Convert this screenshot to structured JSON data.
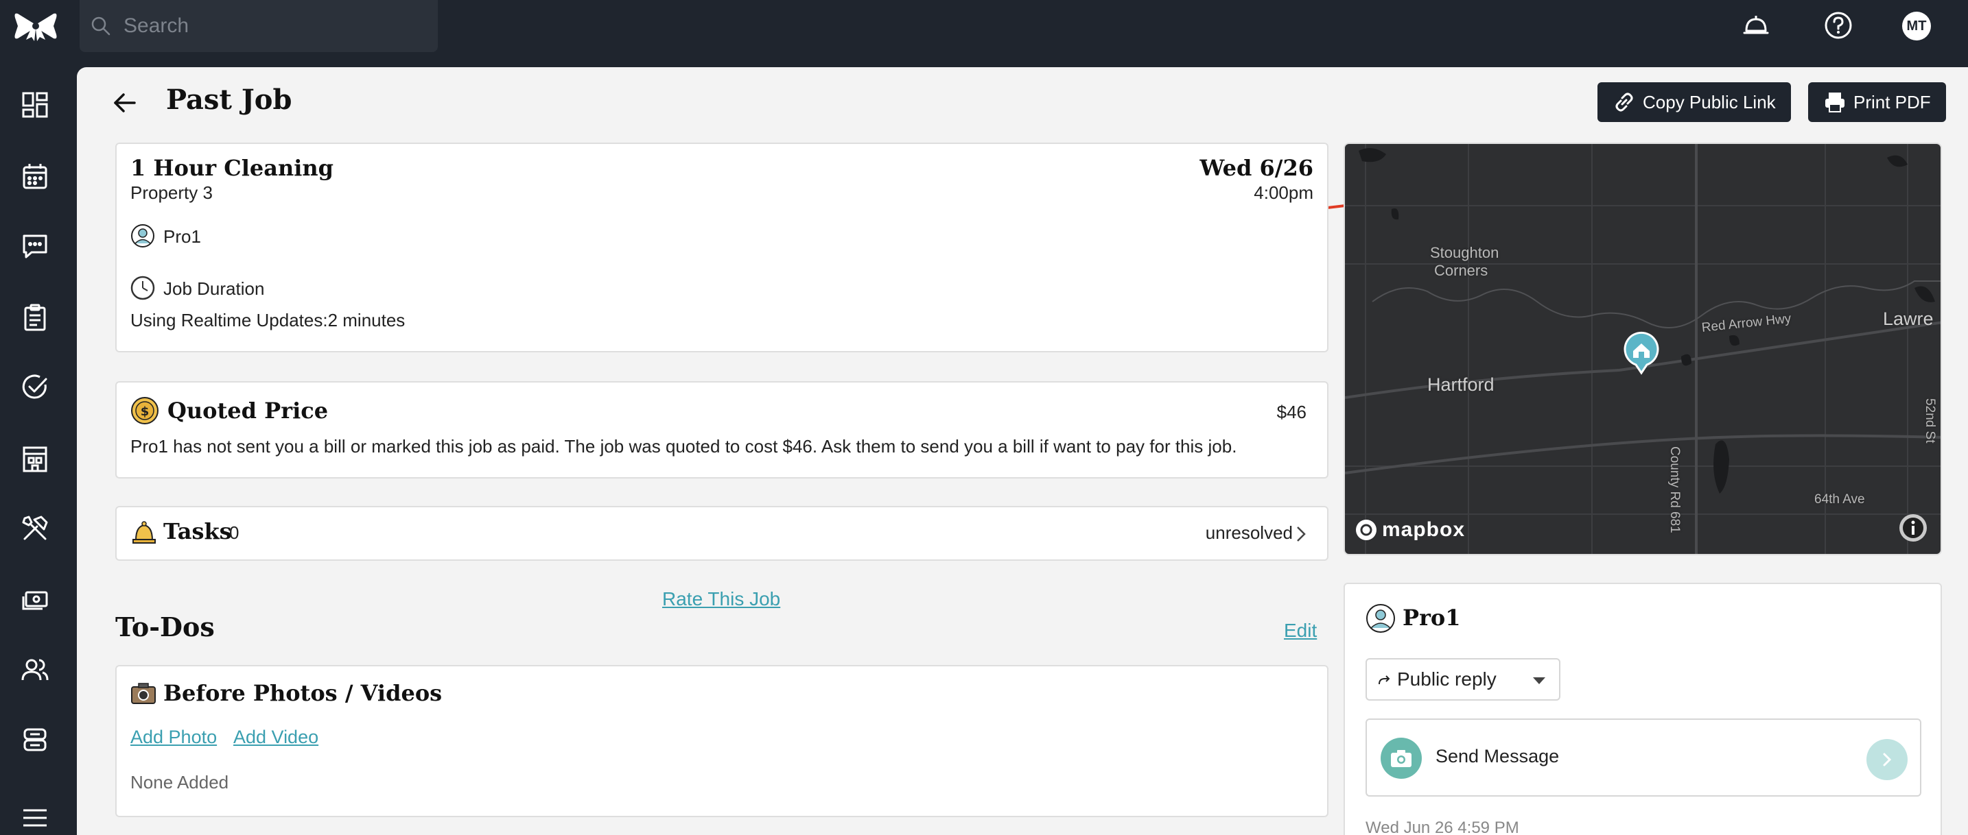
{
  "topbar": {
    "search_placeholder": "Search",
    "avatar_initials": "MT",
    "icons": [
      "bow-logo-icon",
      "search-icon",
      "service-bell-icon",
      "help-icon"
    ]
  },
  "sidebar": {
    "icons": [
      "dashboard-icon",
      "calendar-icon",
      "messages-icon",
      "checklist-icon",
      "check-circle-icon",
      "building-icon",
      "tools-icon",
      "money-icon",
      "users-icon",
      "robot-icon",
      "menu-icon"
    ]
  },
  "page": {
    "title": "Past Job",
    "copy_link_label": "Copy Public Link",
    "print_pdf_label": "Print PDF"
  },
  "job": {
    "title": "1 Hour Cleaning",
    "property": "Property 3",
    "date": "Wed 6/26",
    "time": "4:00pm",
    "pro_name": "Pro1",
    "duration_label": "Job Duration",
    "realtime_updates": "Using Realtime Updates:2 minutes"
  },
  "quote": {
    "title": "Quoted Price",
    "amount": "$46",
    "message": "Pro1 has not sent you a bill or marked this job as paid. The job was quoted to cost $46. Ask them to send you a bill if want to pay for this job."
  },
  "tasks": {
    "title": "Tasks",
    "count": "0",
    "status": "unresolved"
  },
  "rate_job_label": "Rate This Job",
  "todos": {
    "title": "To-Dos",
    "edit_label": "Edit",
    "before_title": "Before Photos / Videos",
    "add_photo_label": "Add Photo",
    "add_video_label": "Add Video",
    "none_added": "None Added"
  },
  "map": {
    "labels": {
      "stoughton_1": "Stoughton",
      "stoughton_2": "Corners",
      "hartford": "Hartford",
      "red_arrow": "Red Arrow Hwy",
      "lawrence": "Lawre",
      "county_rd": "County Rd 681",
      "ave_64": "64th Ave",
      "st_52": "52nd St"
    },
    "attribution": "mapbox"
  },
  "pro_panel": {
    "name": "Pro1",
    "reply_option": "Public reply",
    "message_placeholder": "Send Message",
    "timestamp": "Wed Jun 26 4:59 PM"
  },
  "colors": {
    "dark": "#1f252e",
    "accent": "#3a9fb0",
    "arrow": "#e03b24"
  }
}
